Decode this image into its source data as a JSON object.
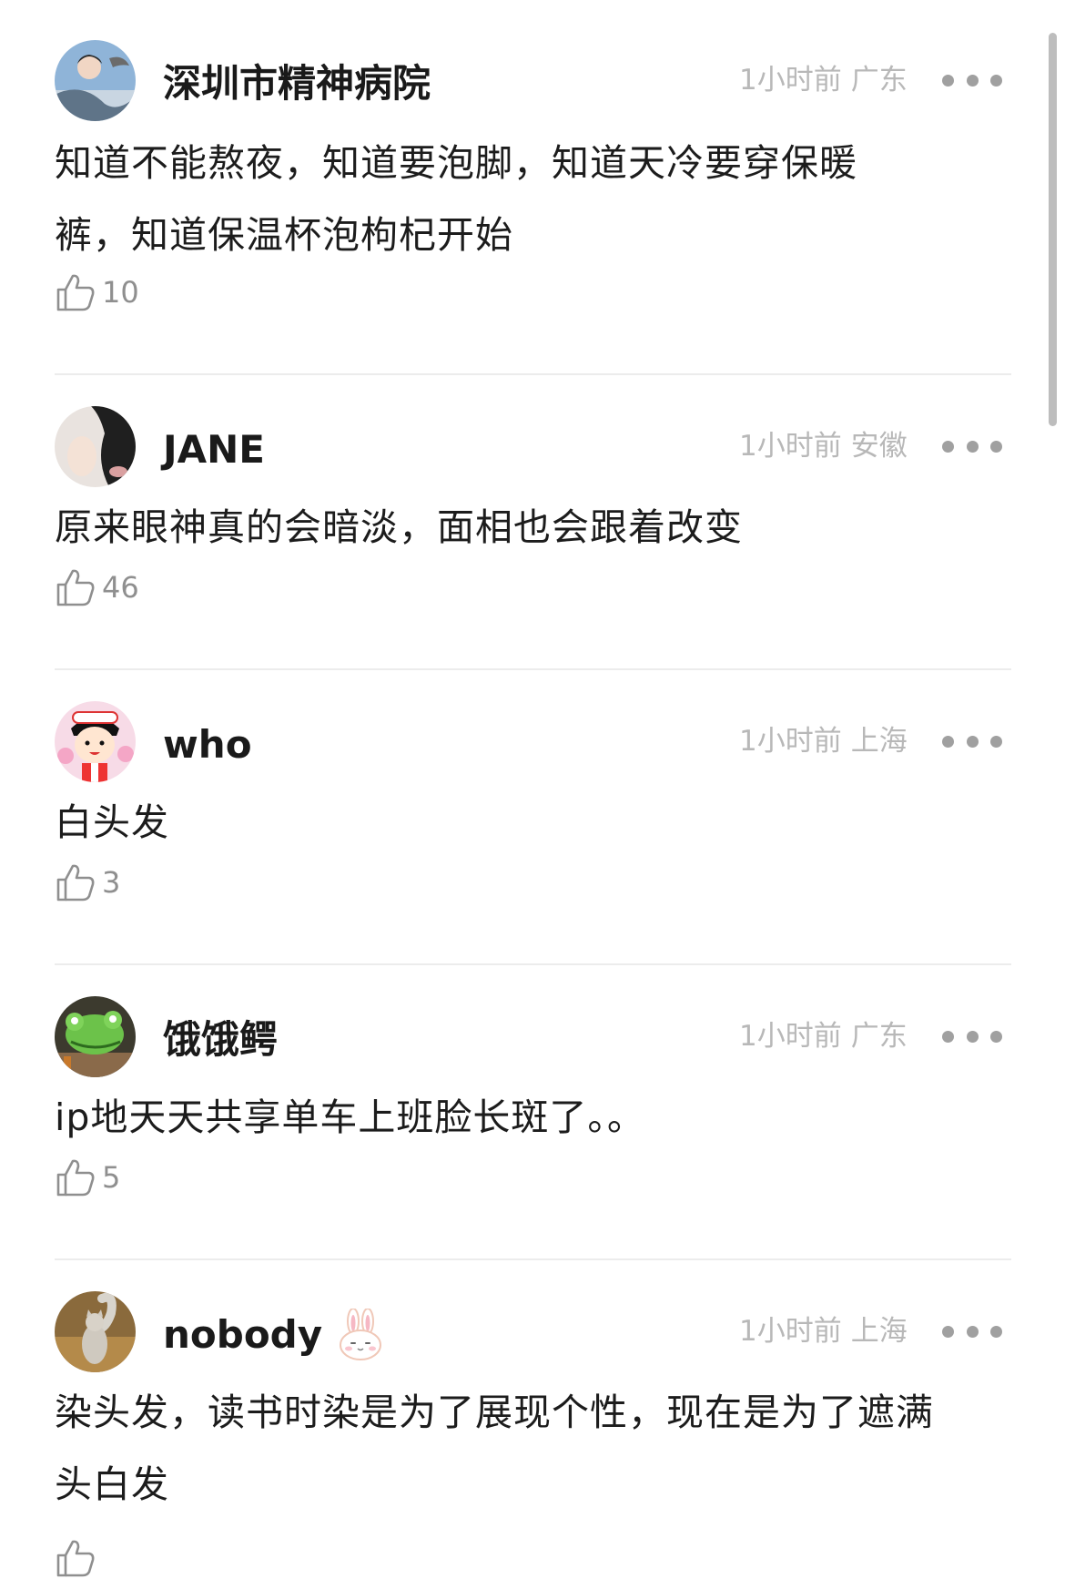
{
  "comments": [
    {
      "username": "深圳市精神病院",
      "time": "1小时前",
      "location": "广东",
      "text": "知道不能熬夜，知道要泡脚，知道天冷要穿保暖裤，知道保温杯泡枸杞开始",
      "likes": "10"
    },
    {
      "username": "JANE",
      "time": "1小时前",
      "location": "安徽",
      "text": "原来眼神真的会暗淡，面相也会跟着改变",
      "likes": "46"
    },
    {
      "username": "who",
      "time": "1小时前",
      "location": "上海",
      "text": "白头发",
      "likes": "3"
    },
    {
      "username": "饿饿鳄",
      "time": "1小时前",
      "location": "广东",
      "text": "ip地天天共享单车上班脸长斑了。。",
      "likes": "5"
    },
    {
      "username": "nobody",
      "time": "1小时前",
      "location": "上海",
      "text": "染头发，读书时染是为了展现个性，现在是为了遮满头白发",
      "badge_icon": "bunny-badge-icon"
    }
  ]
}
